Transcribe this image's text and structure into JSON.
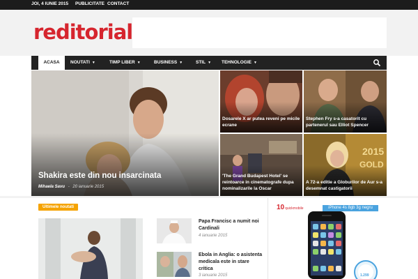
{
  "topbar": {
    "date": "JOI, 4 IUNIE 2015",
    "links": [
      "PUBLICITATE",
      "CONTACT"
    ]
  },
  "brand": {
    "logo": "reditorial",
    "logo_color": "#d6252e"
  },
  "nav": {
    "items": [
      {
        "label": "ACASA",
        "active": true,
        "dropdown": false
      },
      {
        "label": "NOUTATI",
        "active": false,
        "dropdown": true
      },
      {
        "label": "TIMP LIBER",
        "active": false,
        "dropdown": true
      },
      {
        "label": "BUSINESS",
        "active": false,
        "dropdown": true
      },
      {
        "label": "STIL",
        "active": false,
        "dropdown": true
      },
      {
        "label": "TEHNOLOGIE",
        "active": false,
        "dropdown": true
      }
    ],
    "search_icon": "search-icon"
  },
  "featured": {
    "main": {
      "title": "Shakira este din nou insarcinata",
      "author": "Mihaela Savu",
      "separator": "-",
      "date": "20 ianuarie 2015"
    },
    "tiles": [
      {
        "title": "Dosarele X ar putea reveni pe micile ecrane"
      },
      {
        "title": "Stephen Fry s-a casatorit cu partenerul sau Elliot Spencer"
      },
      {
        "title": "'The Grand Budapest Hotel' se reintoarce in cinematografe dupa nominalizarile la Oscar"
      },
      {
        "title": "A 72-a editie a Globurilor de Aur s-a desemnat castigatorii"
      }
    ]
  },
  "latest": {
    "badge": "Ultimele noutati",
    "badge_color": "#f5a300",
    "items": [
      {
        "title": "Papa Francisc a numit noi Cardinali",
        "date": "4 ianuarie 2015"
      },
      {
        "title": "Ebola in Anglia: o asistenta medicala este in stare critica",
        "date": "3 ianuarie 2015"
      }
    ]
  },
  "ad": {
    "brand_num": "10",
    "brand_name": "quickmobile",
    "models": "iPhone 4s 8gb 3g negru",
    "price": "1.299"
  }
}
